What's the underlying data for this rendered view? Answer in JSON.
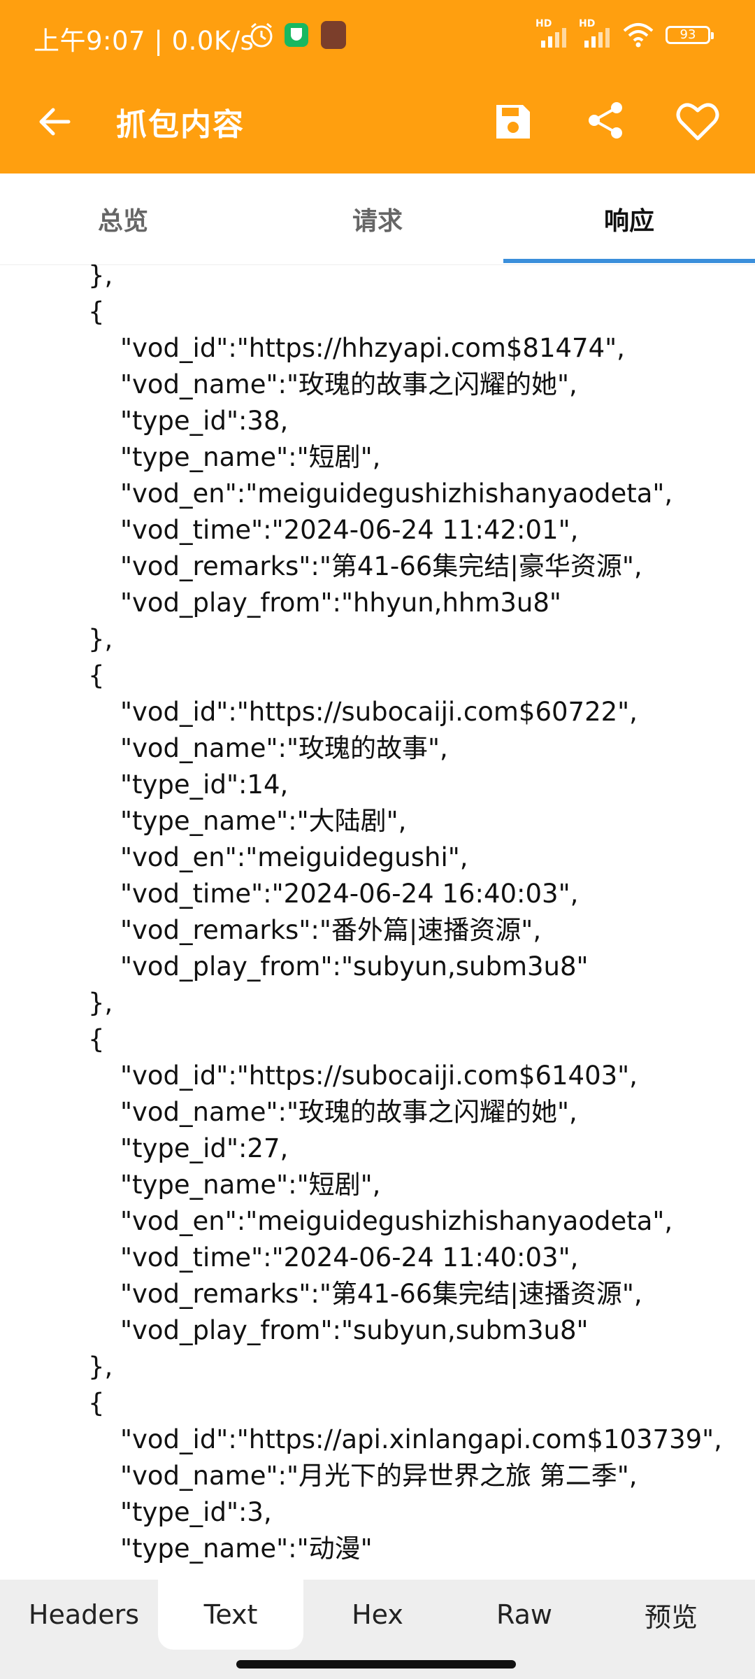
{
  "status_bar": {
    "time": "上午9:07 | 0.0K/s",
    "battery": "93",
    "signal1": "HD",
    "signal2": "HD"
  },
  "app_bar": {
    "title": "抓包内容",
    "back_icon": "arrow-back-icon",
    "save_icon": "save-icon",
    "share_icon": "share-icon",
    "favorite_icon": "heart-icon"
  },
  "tabs": [
    {
      "label": "总览",
      "selected": false
    },
    {
      "label": "请求",
      "selected": false
    },
    {
      "label": "响应",
      "selected": true
    }
  ],
  "body_lines": [
    {
      "text": "\"vod_play_from\":\"hhyun,hhm3u8\"",
      "indent": 2
    },
    {
      "text": "},",
      "indent": 1
    },
    {
      "text": "{",
      "indent": 1
    },
    {
      "text": "\"vod_id\":\"https://hhzyapi.com$81474\",",
      "indent": 2
    },
    {
      "text": "\"vod_name\":\"玫瑰的故事之闪耀的她\",",
      "indent": 2
    },
    {
      "text": "\"type_id\":38,",
      "indent": 2
    },
    {
      "text": "\"type_name\":\"短剧\",",
      "indent": 2
    },
    {
      "text": "\"vod_en\":\"meiguidegushizhishanyaodeta\",",
      "indent": 2
    },
    {
      "text": "\"vod_time\":\"2024-06-24 11:42:01\",",
      "indent": 2
    },
    {
      "text": "\"vod_remarks\":\"第41-66集完结|豪华资源\",",
      "indent": 2
    },
    {
      "text": "\"vod_play_from\":\"hhyun,hhm3u8\"",
      "indent": 2
    },
    {
      "text": "},",
      "indent": 1
    },
    {
      "text": "{",
      "indent": 1
    },
    {
      "text": "\"vod_id\":\"https://subocaiji.com$60722\",",
      "indent": 2
    },
    {
      "text": "\"vod_name\":\"玫瑰的故事\",",
      "indent": 2
    },
    {
      "text": "\"type_id\":14,",
      "indent": 2
    },
    {
      "text": "\"type_name\":\"大陆剧\",",
      "indent": 2
    },
    {
      "text": "\"vod_en\":\"meiguidegushi\",",
      "indent": 2
    },
    {
      "text": "\"vod_time\":\"2024-06-24 16:40:03\",",
      "indent": 2
    },
    {
      "text": "\"vod_remarks\":\"番外篇|速播资源\",",
      "indent": 2
    },
    {
      "text": "\"vod_play_from\":\"subyun,subm3u8\"",
      "indent": 2
    },
    {
      "text": "},",
      "indent": 1
    },
    {
      "text": "{",
      "indent": 1
    },
    {
      "text": "\"vod_id\":\"https://subocaiji.com$61403\",",
      "indent": 2
    },
    {
      "text": "\"vod_name\":\"玫瑰的故事之闪耀的她\",",
      "indent": 2
    },
    {
      "text": "\"type_id\":27,",
      "indent": 2
    },
    {
      "text": "\"type_name\":\"短剧\",",
      "indent": 2
    },
    {
      "text": "\"vod_en\":\"meiguidegushizhishanyaodeta\",",
      "indent": 2
    },
    {
      "text": "\"vod_time\":\"2024-06-24 11:40:03\",",
      "indent": 2
    },
    {
      "text": "\"vod_remarks\":\"第41-66集完结|速播资源\",",
      "indent": 2
    },
    {
      "text": "\"vod_play_from\":\"subyun,subm3u8\"",
      "indent": 2
    },
    {
      "text": "},",
      "indent": 1
    },
    {
      "text": "{",
      "indent": 1
    },
    {
      "text": "\"vod_id\":\"https://api.xinlangapi.com$103739\",",
      "indent": 2
    },
    {
      "text": "\"vod_name\":\"月光下的异世界之旅 第二季\",",
      "indent": 2
    },
    {
      "text": "\"type_id\":3,",
      "indent": 2
    },
    {
      "text": "\"type_name\":\"动漫\"",
      "indent": 2
    }
  ],
  "bottom_tabs": [
    {
      "label": "Headers",
      "selected": false
    },
    {
      "label": "Text",
      "selected": true
    },
    {
      "label": "Hex",
      "selected": false
    },
    {
      "label": "Raw",
      "selected": false
    },
    {
      "label": "预览",
      "selected": false
    }
  ],
  "colors": {
    "app_bar": "#FF9F0F",
    "tab_indicator": "#3B8FDB",
    "bottom_bar": "#eeeeee"
  }
}
